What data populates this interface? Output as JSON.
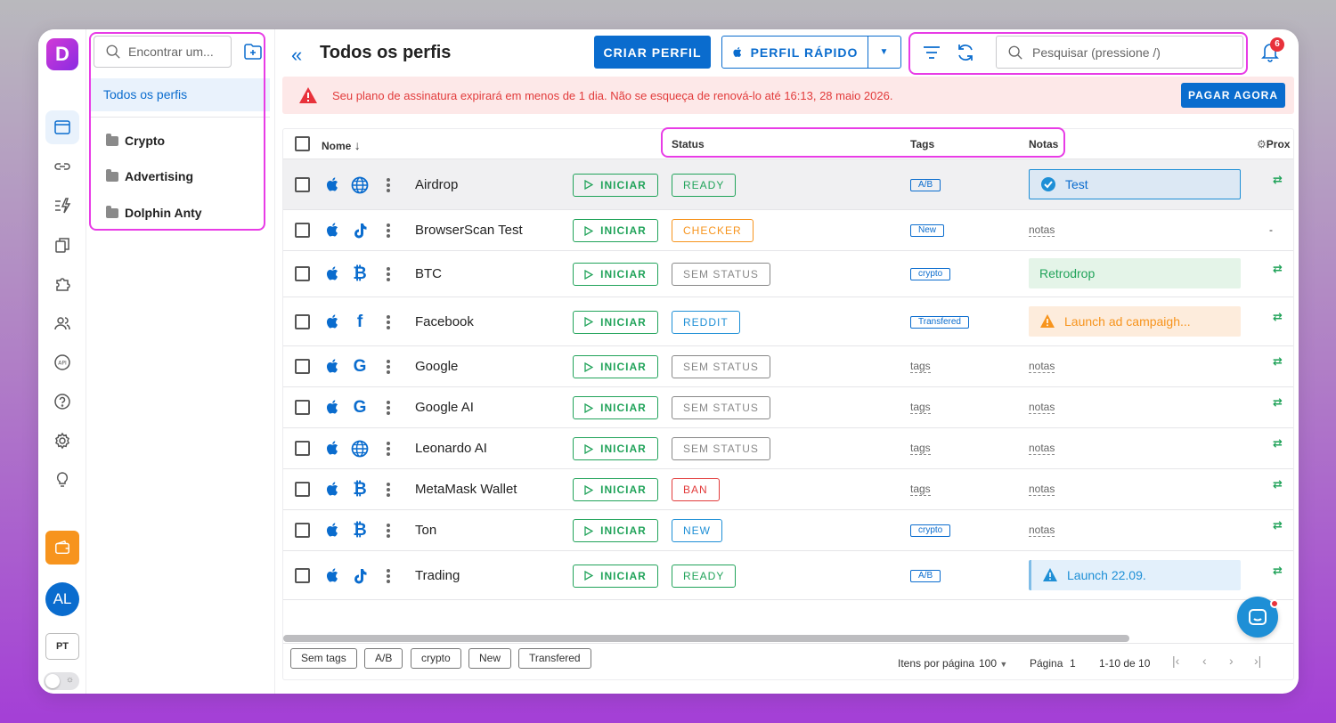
{
  "app": {
    "logo_letter": "D",
    "accent": "#0a6cce"
  },
  "rail": {
    "avatar_initials": "AL",
    "language": "PT"
  },
  "folders": {
    "search_placeholder": "Encontrar um...",
    "all_profiles": "Todos os perfis",
    "items": [
      {
        "label": "Crypto"
      },
      {
        "label": "Advertising"
      },
      {
        "label": "Dolphin Anty"
      }
    ]
  },
  "header": {
    "title": "Todos os perfis",
    "create_button": "CRIAR PERFIL",
    "quick_button": "PERFIL RÁPIDO",
    "search_placeholder": "Pesquisar (pressione /)",
    "notification_count": "6"
  },
  "banner": {
    "text": "Seu plano de assinatura expirará em menos de 1 dia. Não se esqueça de renová-lo até 16:13, 28 maio 2026.",
    "button": "PAGAR AGORA"
  },
  "table": {
    "columns": {
      "name": "Nome",
      "status": "Status",
      "tags": "Tags",
      "notes": "Notas",
      "proxy": "Prox"
    },
    "start_label": "INICIAR",
    "rows": [
      {
        "name": "Airdrop",
        "icon": "globe-icon",
        "status": "READY",
        "status_color": "#21a35a",
        "tag": "A/B",
        "note": "Test",
        "note_type": "check",
        "proxy": "⇄"
      },
      {
        "name": "BrowserScan Test",
        "icon": "tiktok-icon",
        "status": "CHECKER",
        "status_color": "#f7941d",
        "tag": "New",
        "note": "notas",
        "note_type": "empty",
        "proxy": "-"
      },
      {
        "name": "BTC",
        "icon": "bitcoin-icon",
        "status": "SEM STATUS",
        "status_color": "#888888",
        "tag": "crypto",
        "note": "Retrodrop",
        "note_type": "green",
        "proxy": "⇄"
      },
      {
        "name": "Facebook",
        "icon": "facebook-icon",
        "status": "REDDIT",
        "status_color": "#1e8fd6",
        "tag": "Transfered",
        "note": "Launch ad campaigh...",
        "note_type": "orange",
        "proxy": "⇄"
      },
      {
        "name": "Google",
        "icon": "google-icon",
        "status": "SEM STATUS",
        "status_color": "#888888",
        "tag": "tags",
        "tag_empty": true,
        "note": "notas",
        "note_type": "empty",
        "proxy": "⇄"
      },
      {
        "name": "Google AI",
        "icon": "google-icon",
        "status": "SEM STATUS",
        "status_color": "#888888",
        "tag": "tags",
        "tag_empty": true,
        "note": "notas",
        "note_type": "empty",
        "proxy": "⇄"
      },
      {
        "name": "Leonardo AI",
        "icon": "globe-icon",
        "status": "SEM STATUS",
        "status_color": "#888888",
        "tag": "tags",
        "tag_empty": true,
        "note": "notas",
        "note_type": "empty",
        "proxy": "⇄"
      },
      {
        "name": "MetaMask Wallet",
        "icon": "bitcoin-icon",
        "status": "BAN",
        "status_color": "#e23b3b",
        "tag": "tags",
        "tag_empty": true,
        "note": "notas",
        "note_type": "empty",
        "proxy": "⇄"
      },
      {
        "name": "Ton",
        "icon": "bitcoin-icon",
        "status": "NEW",
        "status_color": "#1e8fd6",
        "tag": "crypto",
        "note": "notas",
        "note_type": "empty",
        "proxy": "⇄"
      },
      {
        "name": "Trading",
        "icon": "tiktok-icon",
        "status": "READY",
        "status_color": "#21a35a",
        "tag": "A/B",
        "note": "Launch 22.09.",
        "note_type": "blue",
        "proxy": "⇄"
      }
    ]
  },
  "footer": {
    "chips": [
      "Sem tags",
      "A/B",
      "crypto",
      "New",
      "Transfered"
    ],
    "per_page_label": "Itens por página",
    "per_page_value": "100",
    "page_label": "Página",
    "page_value": "1",
    "range": "1-10 de 10"
  }
}
